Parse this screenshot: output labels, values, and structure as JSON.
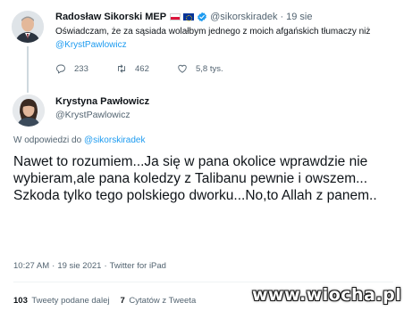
{
  "quoted_tweet": {
    "author_name": "Radosław Sikorski MEP",
    "handle": "@sikorskiradek",
    "separator": "·",
    "date": "19 sie",
    "text": "Oświadczam, że za sąsiada wolałbym jednego z moich afgańskich tłumaczy niż ",
    "mention": "@KrystPawlowicz",
    "replies": "233",
    "retweets": "462",
    "likes": "5,8 tys."
  },
  "tweet": {
    "author_name": "Krystyna Pawłowicz",
    "handle": "@KrystPawlowicz",
    "reply_prefix": "W odpowiedzi do",
    "reply_mention": "@sikorskiradek",
    "text": "Nawet to rozumiem...Ja się w pana okolice wprawdzie nie wybieram,ale pana koledzy z Talibanu pewnie i owszem...\nSzkoda tylko tego polskiego dworku...No,to Allah z panem..",
    "time": "10:27 AM",
    "separator": "·",
    "date": "19 sie 2021",
    "source": "Twitter for iPad"
  },
  "stats": {
    "retweets_count": "103",
    "retweets_label": "Tweety podane dalej",
    "quotes_count": "7",
    "quotes_label": "Cytatów z Tweeta",
    "likes_count": "",
    "likes_label": ""
  },
  "watermark": "www.wiocha.pl",
  "icons": {
    "verified": "verified-badge-icon",
    "flag_pl": "poland-flag-icon",
    "flag_eu": "eu-flag-icon",
    "reply": "reply-icon",
    "retweet": "retweet-icon",
    "like": "like-icon"
  },
  "colors": {
    "accent": "#1d9bf0",
    "text": "#0f1419",
    "secondary": "#536471"
  }
}
